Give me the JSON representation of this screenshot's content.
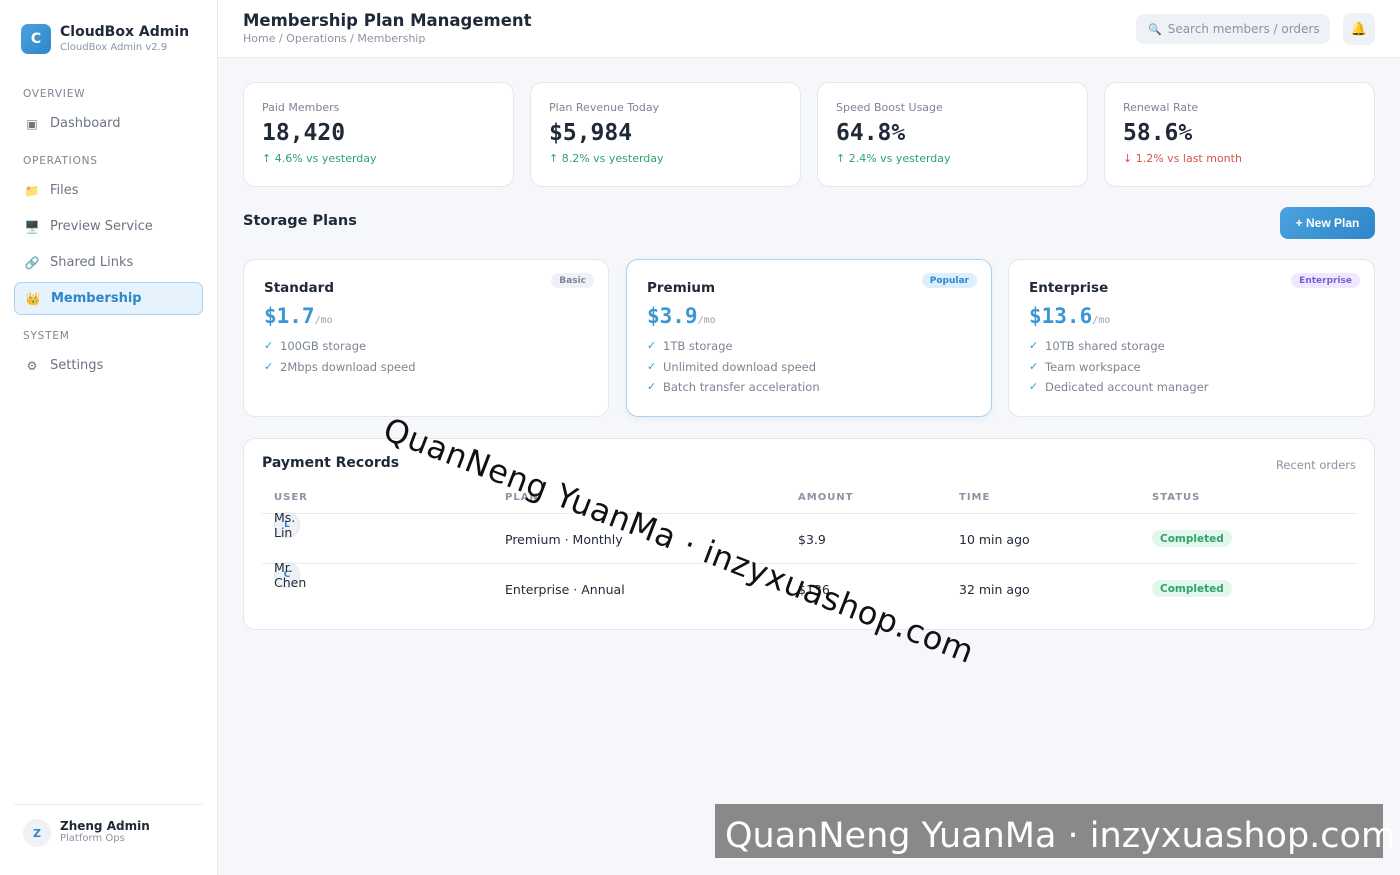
{
  "brand": {
    "logo_letter": "C",
    "title": "CloudBox Admin",
    "subtitle": "CloudBox Admin v2.9"
  },
  "sidebar": {
    "sections": [
      "OVERVIEW",
      "OPERATIONS",
      "SYSTEM"
    ],
    "items": [
      {
        "label": "Dashboard",
        "icon": "▣"
      },
      {
        "label": "Files",
        "icon": "📁"
      },
      {
        "label": "Preview Service",
        "icon": "🖥️"
      },
      {
        "label": "Shared Links",
        "icon": "🔗"
      },
      {
        "label": "Membership",
        "icon": "👑",
        "active": true
      },
      {
        "label": "Settings",
        "icon": "⚙"
      }
    ],
    "user": {
      "initial": "Z",
      "name": "Zheng Admin",
      "role": "Platform Ops"
    }
  },
  "header": {
    "title": "Membership Plan Management",
    "breadcrumb": "Home / Operations / Membership",
    "search_placeholder": "Search members / orders",
    "search_icon": "🔍",
    "bell_icon": "🔔"
  },
  "stats": [
    {
      "label": "Paid Members",
      "value": "18,420",
      "delta": "↑ 4.6% vs yesterday",
      "trend": "up"
    },
    {
      "label": "Plan Revenue Today",
      "value": "$5,984",
      "delta": "↑ 8.2% vs yesterday",
      "trend": "up"
    },
    {
      "label": "Speed Boost Usage",
      "value": "64.8%",
      "delta": "↑ 2.4% vs yesterday",
      "trend": "up"
    },
    {
      "label": "Renewal Rate",
      "value": "58.6%",
      "delta": "↓ 1.2% vs last month",
      "trend": "down"
    }
  ],
  "plans_section": {
    "title": "Storage Plans",
    "new_plan_label": "+ New Plan"
  },
  "plans": [
    {
      "name": "Standard",
      "price": "$1.7",
      "per": "/mo",
      "badge": "Basic",
      "features": [
        "100GB storage",
        "2Mbps download speed"
      ]
    },
    {
      "name": "Premium",
      "price": "$3.9",
      "per": "/mo",
      "badge": "Popular",
      "features": [
        "1TB storage",
        "Unlimited download speed",
        "Batch transfer acceleration"
      ]
    },
    {
      "name": "Enterprise",
      "price": "$13.6",
      "per": "/mo",
      "badge": "Enterprise",
      "features": [
        "10TB shared storage",
        "Team workspace",
        "Dedicated account manager"
      ]
    }
  ],
  "check_icon": "✓",
  "payments": {
    "title": "Payment Records",
    "subtitle": "Recent orders",
    "columns": [
      "USER",
      "PLAN",
      "AMOUNT",
      "TIME",
      "STATUS"
    ],
    "rows": [
      {
        "initial": "L",
        "user": "Ms. Lin",
        "plan": "Premium · Monthly",
        "amount": "$3.9",
        "time": "10 min ago",
        "status": "Completed"
      },
      {
        "initial": "C",
        "user": "Mr. Chen",
        "plan": "Enterprise · Annual",
        "amount": "$136",
        "time": "32 min ago",
        "status": "Completed"
      }
    ]
  },
  "watermark": "QuanNeng YuanMa · inzyxuashop.com"
}
